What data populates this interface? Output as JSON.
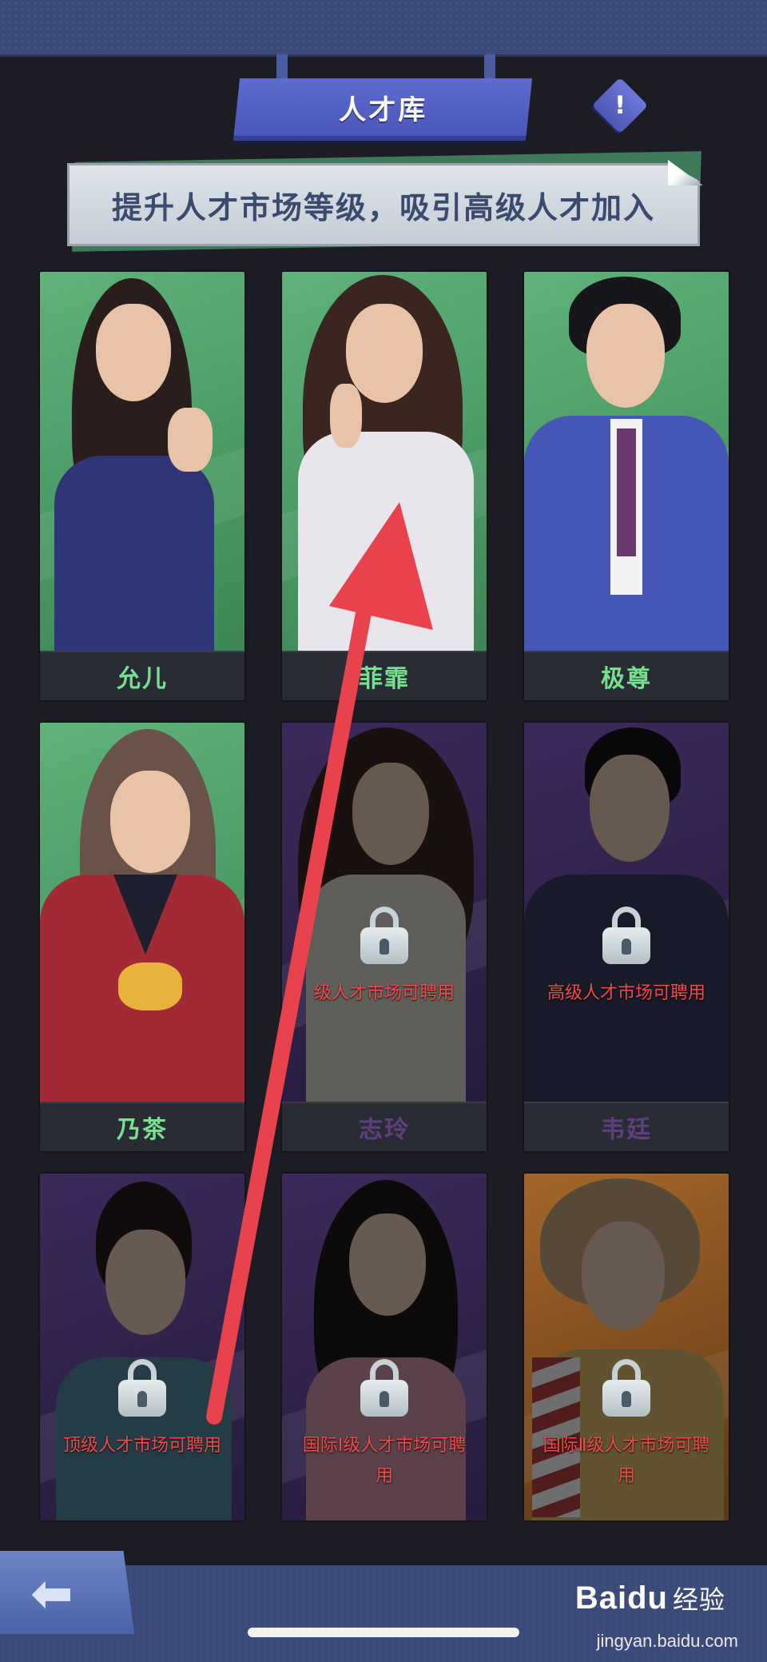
{
  "title": "人才库",
  "info_button": "!",
  "banner": "提升人才市场等级，吸引高级人才加入",
  "talents": [
    {
      "name": "允儿",
      "locked": false,
      "theme": "green"
    },
    {
      "name": "菲霏",
      "locked": false,
      "theme": "green"
    },
    {
      "name": "极尊",
      "locked": false,
      "theme": "green"
    },
    {
      "name": "乃茶",
      "locked": false,
      "theme": "green"
    },
    {
      "name": "志玲",
      "locked": true,
      "theme": "purple",
      "requirement": "级人才市场可聘用"
    },
    {
      "name": "韦廷",
      "locked": true,
      "theme": "purple",
      "requirement": "高级人才市场可聘用"
    },
    {
      "name": "",
      "locked": true,
      "theme": "purple",
      "requirement_lines": [
        "顶级人才市场可聘用"
      ]
    },
    {
      "name": "",
      "locked": true,
      "theme": "purple",
      "requirement_lines": [
        "国际Ⅰ级人才市场可聘",
        "用"
      ]
    },
    {
      "name": "",
      "locked": true,
      "theme": "orange",
      "requirement_lines": [
        "国际Ⅱ级人才市场可聘",
        "用"
      ]
    }
  ],
  "back_button": "⬅",
  "watermark": {
    "brand": "Baidu",
    "suffix": "经验",
    "url": "jingyan.baidu.com"
  },
  "colors": {
    "accent": "#5e6bcf",
    "green_card": "#4a9a65",
    "purple_card": "#2e2148",
    "lock_text": "#f24a4a",
    "annotation": "#e8434d"
  },
  "icons": [
    "info-icon",
    "lock-icon",
    "back-arrow-icon",
    "baidu-paw-icon"
  ]
}
